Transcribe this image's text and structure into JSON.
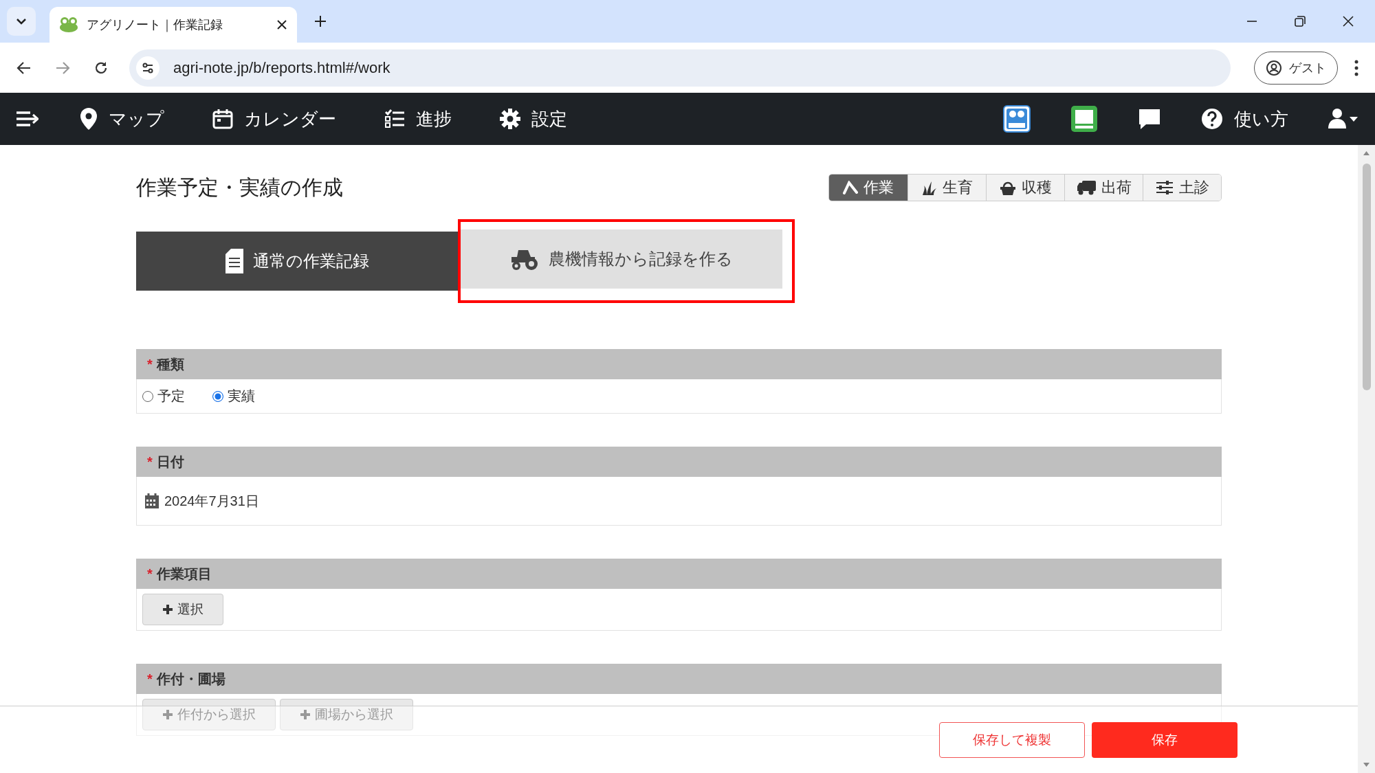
{
  "browser": {
    "tab_title": "アグリノート｜作業記録",
    "url": "agri-note.jp/b/reports.html#/work",
    "profile": "ゲスト"
  },
  "nav": {
    "items": [
      {
        "kind": "pin",
        "label": "マップ"
      },
      {
        "kind": "calendar",
        "label": "カレンダー"
      },
      {
        "kind": "list",
        "label": "進捗"
      },
      {
        "kind": "gear",
        "label": "設定"
      }
    ],
    "help": "使い方"
  },
  "page": {
    "title": "作業予定・実績の作成",
    "tabs": [
      {
        "kind": "sickle",
        "label": "作業",
        "selected": true
      },
      {
        "kind": "grass",
        "label": "生育",
        "selected": false
      },
      {
        "kind": "basket",
        "label": "収穫",
        "selected": false
      },
      {
        "kind": "truck",
        "label": "出荷",
        "selected": false
      },
      {
        "kind": "sliders",
        "label": "土診",
        "selected": false
      }
    ],
    "modes": [
      {
        "kind": "doc",
        "label": "通常の作業記録",
        "selected": true,
        "highlighted": false
      },
      {
        "kind": "tractor",
        "label": "農機情報から記録を作る",
        "selected": false,
        "highlighted": true
      }
    ]
  },
  "sections": [
    {
      "kind": "radios",
      "title": "種類",
      "required_mark": "*",
      "options": [
        {
          "label": "予定",
          "selected": false
        },
        {
          "label": "実績",
          "selected": true
        }
      ]
    },
    {
      "kind": "date",
      "title": "日付",
      "required_mark": "*",
      "value": "2024年7月31日"
    },
    {
      "kind": "buttons",
      "title": "作業項目",
      "required_mark": "*",
      "buttons": [
        "選択"
      ]
    },
    {
      "kind": "buttons",
      "title": "作付・圃場",
      "required_mark": "*",
      "buttons": [
        "作付から選択",
        "圃場から選択"
      ]
    }
  ],
  "footer": {
    "buttons": [
      {
        "kind": "secondary",
        "label": "保存して複製"
      },
      {
        "kind": "primary",
        "label": "保存"
      }
    ]
  }
}
